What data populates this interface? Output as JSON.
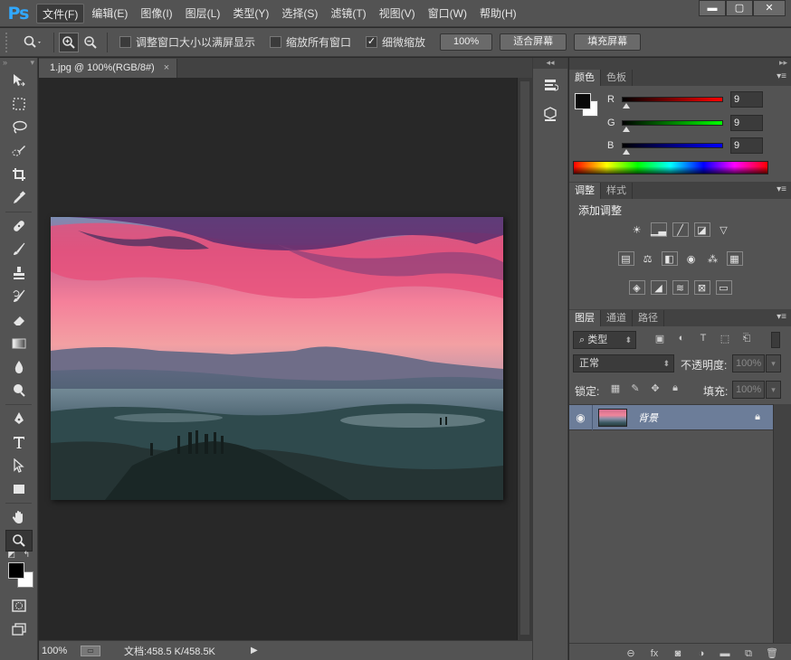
{
  "app": {
    "logo": "Ps"
  },
  "menu": [
    "文件(F)",
    "编辑(E)",
    "图像(I)",
    "图层(L)",
    "类型(Y)",
    "选择(S)",
    "滤镜(T)",
    "视图(V)",
    "窗口(W)",
    "帮助(H)"
  ],
  "window_controls": {
    "minimize": "▬",
    "restore": "▢",
    "close": "✕"
  },
  "options": {
    "resize_windows_label": "调整窗口大小以满屏显示",
    "zoom_all_label": "缩放所有窗口",
    "scrubby_zoom_label": "细微缩放",
    "resize_windows_checked": false,
    "zoom_all_checked": false,
    "scrubby_zoom_checked": true,
    "btn_100": "100%",
    "btn_fit": "适合屏幕",
    "btn_fill": "填充屏幕"
  },
  "document": {
    "tab_title": "1.jpg @ 100%(RGB/8#)",
    "tab_close": "×",
    "zoom": "100%",
    "doc_info": "文档:458.5 K/458.5K",
    "status_arrow": "▶"
  },
  "panels": {
    "color": {
      "tabs": [
        "颜色",
        "色板"
      ],
      "r_label": "R",
      "g_label": "G",
      "b_label": "B",
      "r": "9",
      "g": "9",
      "b": "9",
      "r_color": "#d81f1f",
      "g_color": "#1fc41f",
      "b_color": "#1f3fd8"
    },
    "adjustments": {
      "tabs": [
        "调整",
        "样式"
      ],
      "title": "添加调整"
    },
    "layers": {
      "tabs": [
        "图层",
        "通道",
        "路径"
      ],
      "filter": "类型",
      "blend_mode": "正常",
      "opacity_label": "不透明度:",
      "opacity": "100%",
      "lock_label": "锁定:",
      "fill_label": "填充:",
      "fill": "100%",
      "layer_name": "背景"
    }
  },
  "colors": {
    "fg": "#090909",
    "bg": "#ffffff",
    "layer_selected": "#6c7d99"
  }
}
